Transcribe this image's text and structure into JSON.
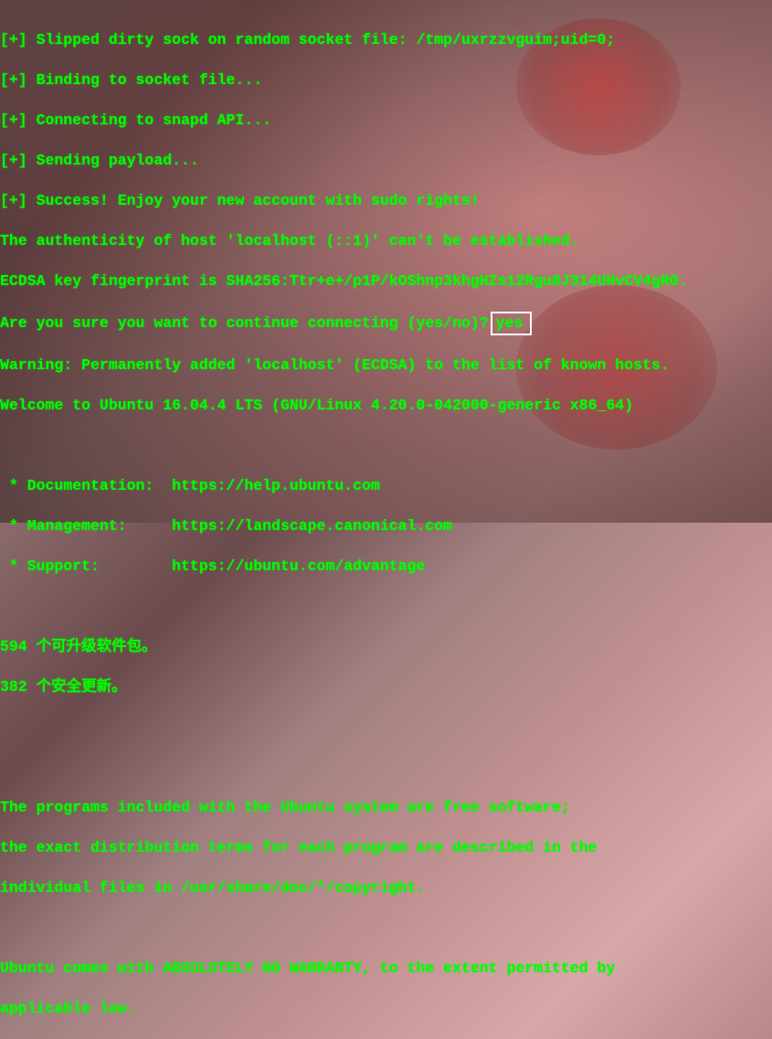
{
  "lines": {
    "l1": "[+] Slipped dirty sock on random socket file: /tmp/uxrzzvguim;uid=0;",
    "l2": "[+] Binding to socket file...",
    "l3": "[+] Connecting to snapd API...",
    "l4": "[+] Sending payload...",
    "l5": "[+] Success! Enjoy your new account with sudo rights!",
    "l6": "The authenticity of host 'localhost (::1)' can't be established.",
    "l7": "ECDSA key fingerprint is SHA256:Ttr+e+/p1P/kOShnp3khgHZs12Rgu8J314UHvCV4gR0.",
    "l8_prompt": "Are you sure you want to continue connecting (yes/no)?",
    "l8_input": "yes",
    "l9": "Warning: Permanently added 'localhost' (ECDSA) to the list of known hosts.",
    "l10": "Welcome to Ubuntu 16.04.4 LTS (GNU/Linux 4.20.0-042000-generic x86_64)",
    "l11": " * Documentation:  https://help.ubuntu.com",
    "l12": " * Management:     https://landscape.canonical.com",
    "l13": " * Support:        https://ubuntu.com/advantage",
    "l14": "594 个可升级软件包。",
    "l15": "382 个安全更新。",
    "l16": "The programs included with the Ubuntu system are free software;",
    "l17": "the exact distribution terms for each program are described in the",
    "l18": "individual files in /usr/share/doc/*/copyright.",
    "l19": "Ubuntu comes with ABSOLUTELY NO WARRANTY, to the extent permitted by",
    "l20": "applicable law."
  }
}
